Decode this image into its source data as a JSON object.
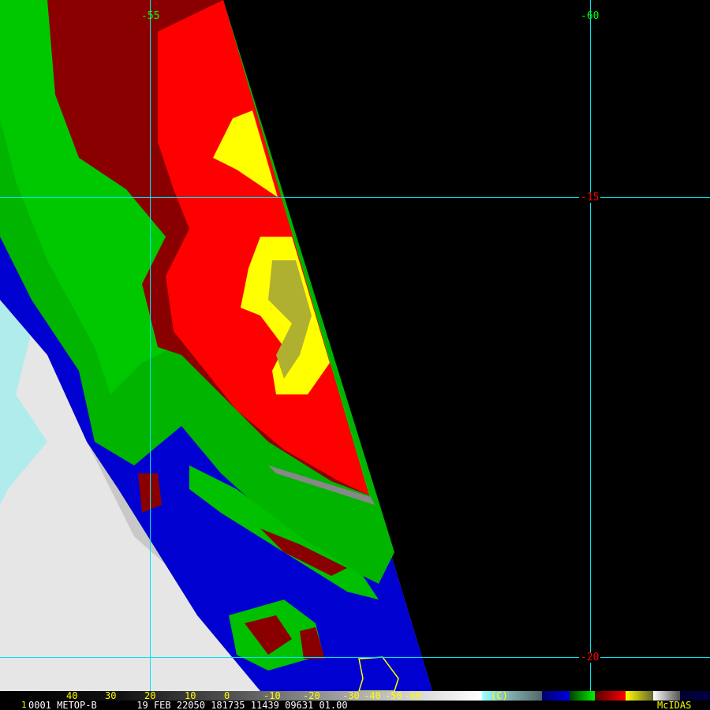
{
  "image": {
    "grid_labels": {
      "lon_left": "-55",
      "lon_right": "-60",
      "lat_top": "-15",
      "lat_bottom": "-20"
    },
    "colorbar": {
      "ticks": [
        "40",
        "30",
        "20",
        "10",
        "0",
        "-10",
        "-20",
        "-30",
        "-40",
        "-50",
        "-60"
      ],
      "unit": "(C)"
    },
    "info": {
      "frame": "1",
      "text": "0001 METOP-B       19 FEB 22050 181735 11439 09631 01.00",
      "brand": "McIDAS"
    },
    "colors": {
      "grid": "#00e5ee",
      "lon_label": "#00ff00",
      "lat_label": "#ff0000",
      "text_yellow": "#ffff00"
    }
  }
}
